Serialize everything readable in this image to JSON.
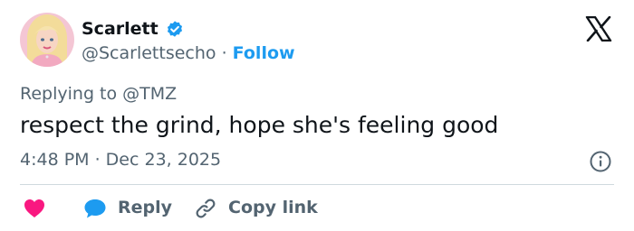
{
  "author": {
    "display_name": "Scarlett",
    "handle": "@Scarlettsecho",
    "separator": "·",
    "follow_label": "Follow",
    "verified_icon": "verified-badge-icon",
    "avatar_icon": "avatar-image"
  },
  "brand": {
    "logo_icon": "x-logo-icon"
  },
  "tweet": {
    "replying_prefix": "Replying to",
    "replying_to": "@TMZ",
    "text": "respect the grind, hope she's feeling good",
    "timestamp": "4:48 PM · Dec 23, 2025",
    "info_icon": "info-icon"
  },
  "actions": {
    "like_icon": "heart-icon",
    "reply_icon": "reply-bubble-icon",
    "reply_label": "Reply",
    "copy_icon": "link-icon",
    "copy_label": "Copy link"
  },
  "colors": {
    "accent": "#1d9bf0",
    "like": "#f91880",
    "text_primary": "#0f1419",
    "text_secondary": "#536471",
    "divider": "#cfd9de"
  }
}
